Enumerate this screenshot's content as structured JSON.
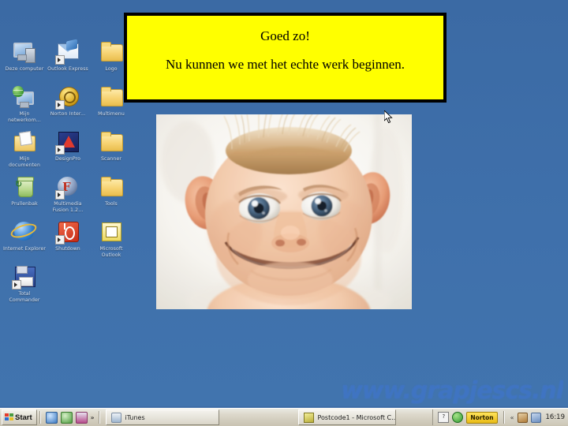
{
  "desktop": {
    "background_color": "#3d6ca6",
    "icons": [
      {
        "label": "Deze computer",
        "art": "my-computer",
        "shortcut": false
      },
      {
        "label": "Outlook Express",
        "art": "outlook-express",
        "shortcut": true
      },
      {
        "label": "Logo",
        "art": "folder",
        "shortcut": false
      },
      {
        "label": "Mijn netwerkom...",
        "art": "network-places",
        "shortcut": false
      },
      {
        "label": "Norton Inter...",
        "art": "norton",
        "shortcut": true
      },
      {
        "label": "Multimenu",
        "art": "folder",
        "shortcut": false
      },
      {
        "label": "Mijn documenten",
        "art": "my-documents",
        "shortcut": false
      },
      {
        "label": "DesignPro",
        "art": "designpro",
        "shortcut": true
      },
      {
        "label": "Scanner",
        "art": "folder",
        "shortcut": false
      },
      {
        "label": "Prullenbak",
        "art": "recycle-bin",
        "shortcut": false
      },
      {
        "label": "Multimedia Fusion 1.2...",
        "art": "multimedia-fusion",
        "shortcut": true
      },
      {
        "label": "Tools",
        "art": "folder",
        "shortcut": false
      },
      {
        "label": "Internet Explorer",
        "art": "internet-explorer",
        "shortcut": false
      },
      {
        "label": "Shutdown",
        "art": "shutdown",
        "shortcut": true
      },
      {
        "label": "Microsoft Outlook",
        "art": "ms-outlook",
        "shortcut": false
      },
      {
        "label": "Total Commander",
        "art": "total-commander",
        "shortcut": true
      }
    ]
  },
  "message_box": {
    "title": "Goed zo!",
    "body": "Nu kunnen we met het echte werk beginnen.",
    "background_color": "#ffff00",
    "border_color": "#000000"
  },
  "photo": {
    "alt": "Vervormd babygezicht met grote oren en brede glimlach",
    "caption": ""
  },
  "watermark": {
    "text": "www.grapjescs.nl",
    "color": "#3f74c4"
  },
  "taskbar": {
    "start_label": "Start",
    "quick_launch": [
      {
        "name": "show-desktop-icon",
        "label": ""
      },
      {
        "name": "browser-icon",
        "label": ""
      },
      {
        "name": "save-icon",
        "label": ""
      },
      {
        "name": "overflow-icon",
        "label": "»"
      }
    ],
    "tasks": [
      {
        "label": "iTunes",
        "icon": "music-note-icon"
      },
      {
        "label": "Postcode1 - Microsoft C...",
        "icon": "window-icon"
      }
    ],
    "tray": {
      "items": [
        {
          "name": "document-icon",
          "label": "?"
        },
        {
          "name": "green-shield-icon",
          "label": ""
        }
      ],
      "norton_label": "Norton",
      "chevron": "«",
      "clock": "16:19"
    }
  }
}
